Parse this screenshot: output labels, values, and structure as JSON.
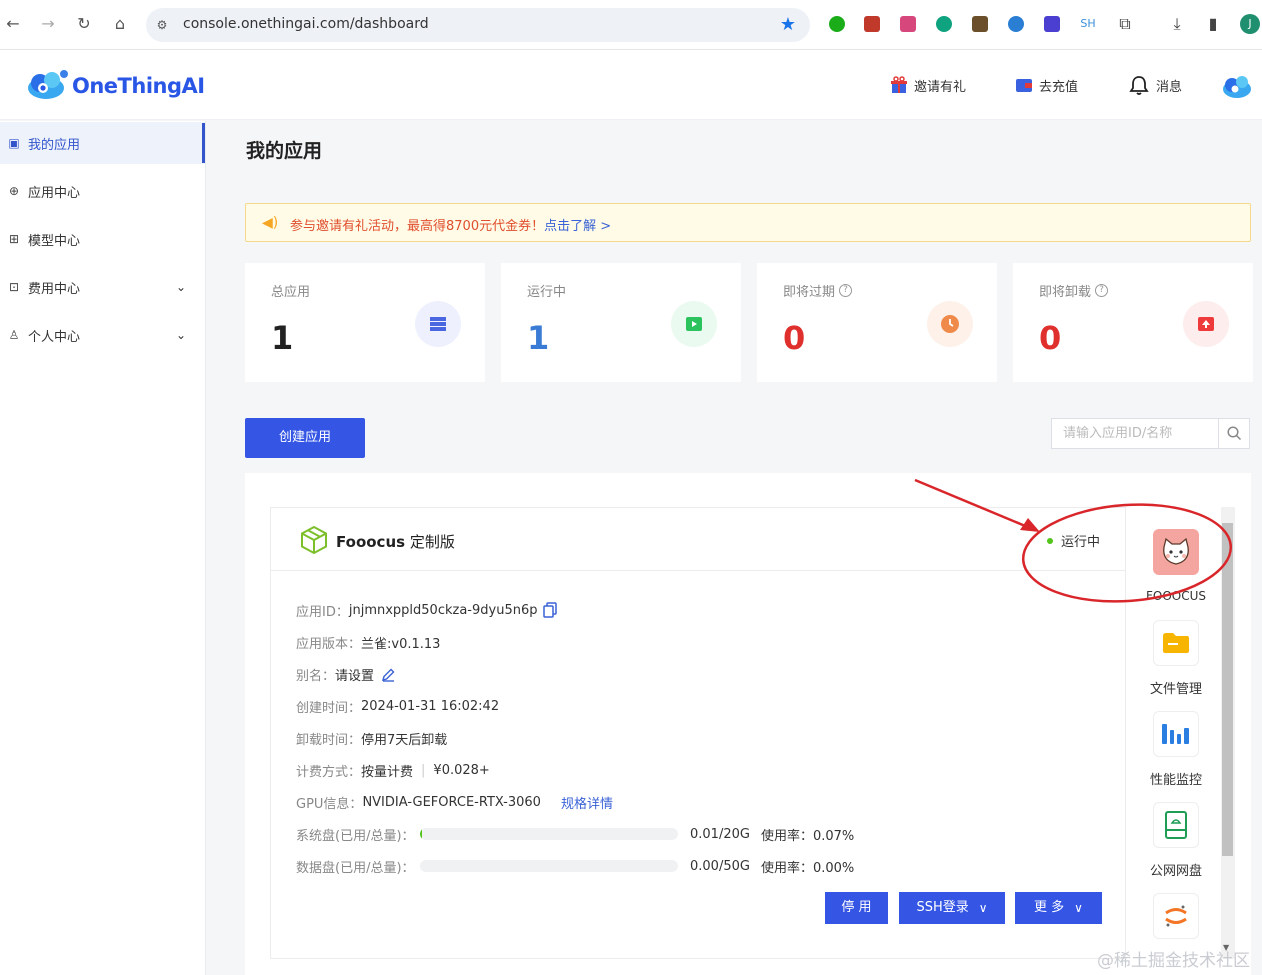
{
  "browser": {
    "url": "console.onethingai.com/dashboard",
    "ext_sh": "SH",
    "profile_initial": "J"
  },
  "header": {
    "logo": "OneThingAI",
    "invite": "邀请有礼",
    "recharge": "去充值",
    "messages": "消息"
  },
  "sidebar": {
    "items": [
      {
        "label": "我的应用"
      },
      {
        "label": "应用中心"
      },
      {
        "label": "模型中心"
      },
      {
        "label": "费用中心"
      },
      {
        "label": "个人中心"
      }
    ]
  },
  "page": {
    "title": "我的应用",
    "notice": "参与邀请有礼活动，最高得8700元代金券！",
    "notice_link": "点击了解 >",
    "create_button": "创建应用",
    "search_placeholder": "请输入应用ID/名称"
  },
  "stats": [
    {
      "label": "总应用",
      "value": "1",
      "color": "#222222",
      "icon_bg": "#eef1fd",
      "icon_color": "#4a66e0"
    },
    {
      "label": "运行中",
      "value": "1",
      "color": "#3a7bd5",
      "icon_bg": "#eafaf0",
      "icon_color": "#2cc25e"
    },
    {
      "label": "即将过期",
      "value": "0",
      "color": "#e0302d",
      "icon_bg": "#fdf1ea",
      "icon_color": "#f08a4b"
    },
    {
      "label": "即将卸载",
      "value": "0",
      "color": "#e0302d",
      "icon_bg": "#fdeded",
      "icon_color": "#ee3a3a"
    }
  ],
  "app": {
    "name_bold": "Fooocus",
    "name_rest": " 定制版",
    "status": "运行中",
    "fields": {
      "id_label": "应用ID：",
      "id_value": "jnjmnxppld50ckza-9dyu5n6p",
      "version_label": "应用版本：",
      "version_value": "兰雀:v0.1.13",
      "alias_label": "别名：",
      "alias_value": "请设置",
      "created_label": "创建时间：",
      "created_value": "2024-01-31 16:02:42",
      "uninstall_label": "卸载时间：",
      "uninstall_value": "停用7天后卸载",
      "billing_label": "计费方式：",
      "billing_value": "按量计费",
      "billing_price": "¥0.028+",
      "gpu_label": "GPU信息：",
      "gpu_value": "NVIDIA-GEFORCE-RTX-3060",
      "gpu_link": "规格详情",
      "sysdisk_label": "系统盘(已用/总量)：",
      "sysdisk_value": "0.01/20G",
      "sysdisk_usage": "使用率：0.07%",
      "sysdisk_fraction": 0.0007,
      "datadisk_label": "数据盘(已用/总量)：",
      "datadisk_value": "0.00/50G",
      "datadisk_usage": "使用率：0.00%",
      "datadisk_fraction": 0.0
    },
    "buttons": {
      "stop": "停 用",
      "ssh": "SSH登录",
      "more": "更 多"
    }
  },
  "rail": {
    "items": [
      {
        "label": "FOOOCUS"
      },
      {
        "label": "文件管理"
      },
      {
        "label": "性能监控"
      },
      {
        "label": "公网网盘"
      }
    ]
  },
  "watermark": "@稀土掘金技术社区"
}
